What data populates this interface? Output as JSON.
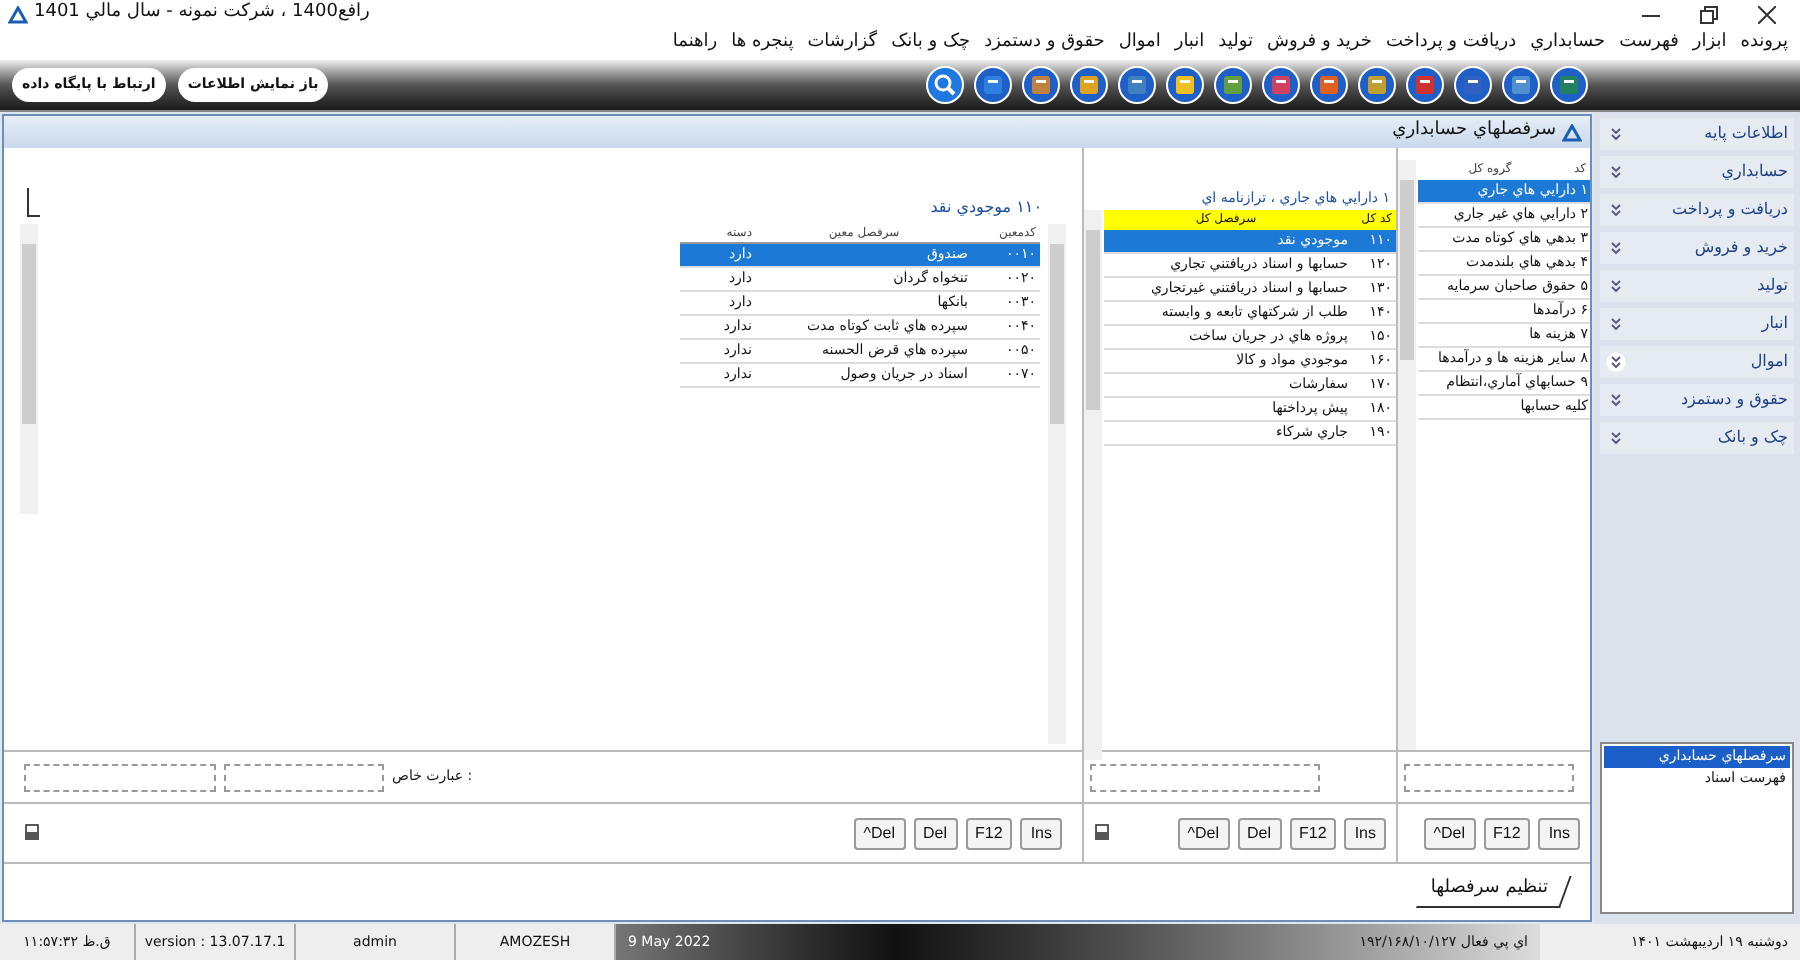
{
  "window": {
    "title": "رافع1400 ، شرکت نمونه - سال مالي 1401"
  },
  "menu": [
    "پرونده",
    "ابزار",
    "فهرست",
    "حسابداري",
    "دريافت و پرداخت",
    "خريد و فروش",
    "توليد",
    "انبار",
    "اموال",
    "حقوق و دستمزد",
    "چک و بانک",
    "گزارشات",
    "پنجره ها",
    "راهنما"
  ],
  "toolbar": {
    "buttons": [
      "باز نمايش اطلاعات",
      "ارتباط با پايگاه داده"
    ]
  },
  "sidebar": {
    "sections": [
      {
        "label": "اطلاعات پايه",
        "selected": false
      },
      {
        "label": "حسابداري",
        "selected": false
      },
      {
        "label": "دريافت و پرداخت",
        "selected": false
      },
      {
        "label": "خريد و فروش",
        "selected": false
      },
      {
        "label": "توليد",
        "selected": false
      },
      {
        "label": "انبار",
        "selected": false
      },
      {
        "label": "اموال",
        "selected": true
      },
      {
        "label": "حقوق و دستمزد",
        "selected": false
      },
      {
        "label": "چک و بانک",
        "selected": false
      }
    ],
    "items": [
      {
        "label": "سرفصلهاي حسابداري",
        "selected": true
      },
      {
        "label": "فهرست اسناد",
        "selected": false
      }
    ]
  },
  "form": {
    "title": "سرفصلهاي حسابداري",
    "groups": {
      "columns": [
        "کد",
        "گروه کل"
      ],
      "rows": [
        {
          "code": "۱",
          "name": "دارايي هاي جاري",
          "selected": true
        },
        {
          "code": "۲",
          "name": "دارايي هاي غير جاري",
          "selected": false
        },
        {
          "code": "۳",
          "name": "بدهي هاي کوتاه مدت",
          "selected": false
        },
        {
          "code": "۴",
          "name": "بدهي هاي بلندمدت",
          "selected": false
        },
        {
          "code": "۵",
          "name": "حقوق صاحبان سرمايه",
          "selected": false
        },
        {
          "code": "۶",
          "name": "درآمدها",
          "selected": false
        },
        {
          "code": "۷",
          "name": "هزينه ها",
          "selected": false
        },
        {
          "code": "۸",
          "name": "ساير هزينه ها و درآمدها",
          "selected": false
        },
        {
          "code": "۹",
          "name": "حسابهاي آماري،انتظام",
          "selected": false
        },
        {
          "name": "کليه حسابها",
          "selected": false
        }
      ],
      "buttons": [
        "Ins",
        "F12",
        "^Del"
      ]
    },
    "general": {
      "heading": "۱ دارايي هاي جاري ، ترازنامه اي",
      "columns": [
        "کد کل",
        "سرفصل کل"
      ],
      "rows": [
        {
          "code": "۱۱۰",
          "name": "موجودي نقد",
          "selected": true
        },
        {
          "code": "۱۲۰",
          "name": "حسابها و اسناد دريافتني تجاري",
          "selected": false
        },
        {
          "code": "۱۳۰",
          "name": "حسابها و اسناد دريافتني غيرتجاري",
          "selected": false
        },
        {
          "code": "۱۴۰",
          "name": "طلب از شرکتهاي تابعه و وابسته",
          "selected": false
        },
        {
          "code": "۱۵۰",
          "name": "پروژه هاي در جريان ساخت",
          "selected": false
        },
        {
          "code": "۱۶۰",
          "name": "موجودي مواد و کالا",
          "selected": false
        },
        {
          "code": "۱۷۰",
          "name": "سفارشات",
          "selected": false
        },
        {
          "code": "۱۸۰",
          "name": "پيش پرداختها",
          "selected": false
        },
        {
          "code": "۱۹۰",
          "name": "جاري شرکاء",
          "selected": false
        }
      ],
      "buttons": [
        "Ins",
        "F12",
        "Del",
        "^Del"
      ]
    },
    "subsidiary": {
      "heading": "۱۱۰ موجودي نقد",
      "columns": [
        "کدمعين",
        "سرفصل معين",
        "دسته"
      ],
      "rows": [
        {
          "code": "۰۰۱۰",
          "name": "صندوق",
          "category": "دارد",
          "selected": true
        },
        {
          "code": "۰۰۲۰",
          "name": "تنخواه گردان",
          "category": "دارد",
          "selected": false
        },
        {
          "code": "۰۰۳۰",
          "name": "بانکها",
          "category": "دارد",
          "selected": false
        },
        {
          "code": "۰۰۴۰",
          "name": "سپرده هاي ثابت کوتاه مدت",
          "category": "ندارد",
          "selected": false
        },
        {
          "code": "۰۰۵۰",
          "name": "سپرده هاي قرض الحسنه",
          "category": "ندارد",
          "selected": false
        },
        {
          "code": "۰۰۷۰",
          "name": "اسناد در جريان وصول",
          "category": "ندارد",
          "selected": false
        }
      ],
      "filter_label": "عبارت خاص :",
      "buttons": [
        "Ins",
        "F12",
        "Del",
        "^Del"
      ]
    },
    "tab": "تنظيم سرفصلها"
  },
  "status_bar": [
    "دوشنبه ۱۹ ارديبهشت ۱۴۰۱",
    "اي پي فعال ۱۹۲/۱۶۸/۱۰/۱۲۷",
    "9 May 2022",
    "AMOZESH",
    "admin",
    "version : 13.07.17.1",
    "۱۱:۵۷:۳۲ ق.ظ"
  ]
}
